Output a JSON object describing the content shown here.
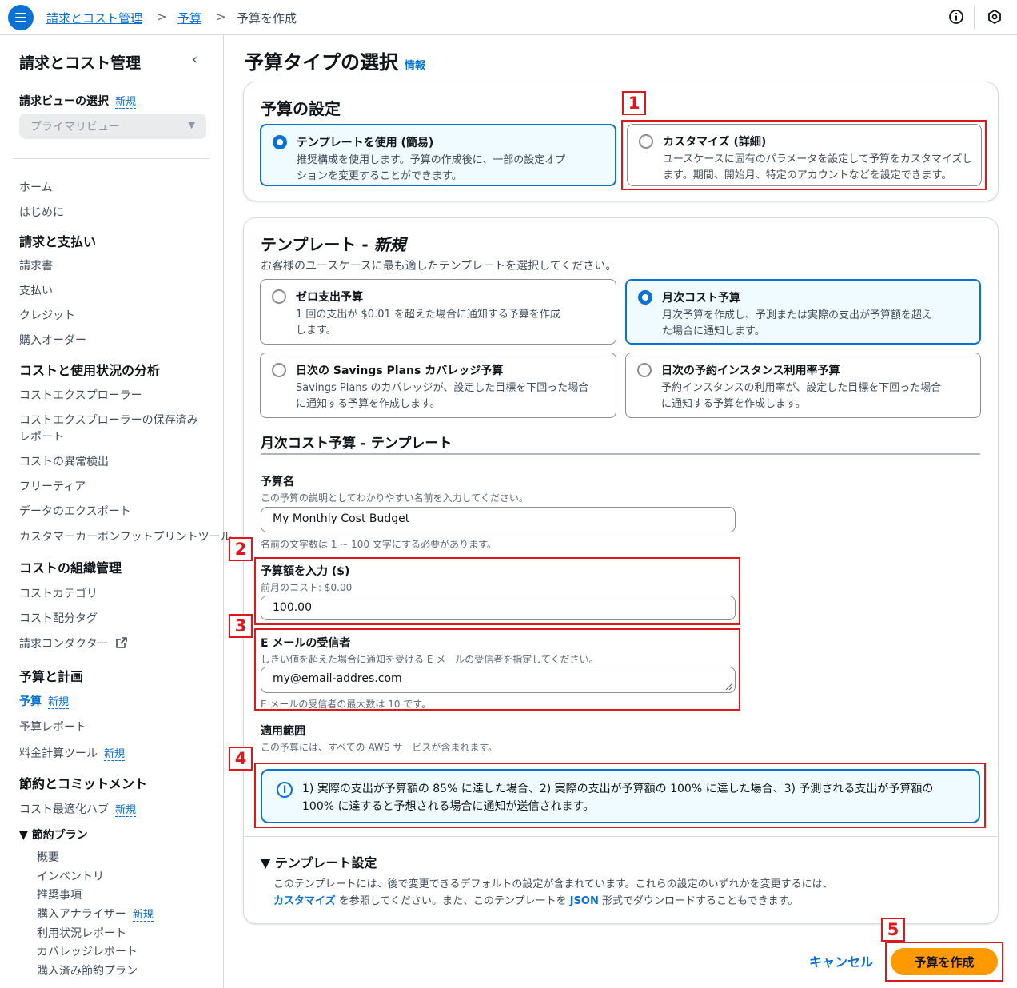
{
  "breadcrumb": {
    "item1": "請求とコスト管理",
    "item2": "予算",
    "current": "予算を作成",
    "separator": ">"
  },
  "sidebar": {
    "title": "請求とコスト管理",
    "billing_view_label": "請求ビューの選択",
    "billing_view_new": "新規",
    "billing_view_value": "プライマリビュー",
    "items": {
      "home": "ホーム",
      "getting_started": "はじめに",
      "billing_payments_head": "請求と支払い",
      "bills": "請求書",
      "payments": "支払い",
      "credits": "クレジット",
      "purchase_orders": "購入オーダー",
      "cost_analysis_head": "コストと使用状況の分析",
      "cost_explorer": "コストエクスプローラー",
      "cost_explorer_saved_1": "コストエクスプローラーの保存済み",
      "cost_explorer_saved_2": "レポート",
      "anomaly": "コストの異常検出",
      "free_tier": "フリーティア",
      "data_exports": "データのエクスポート",
      "carbon": "カスタマーカーボンフットプリントツール",
      "cost_org_head": "コストの組織管理",
      "cost_categories": "コストカテゴリ",
      "cost_tags": "コスト配分タグ",
      "billing_conductor": "請求コンダクター",
      "budget_plan_head": "予算と計画",
      "budgets": "予算",
      "budgets_new": "新規",
      "budget_reports": "予算レポート",
      "pricing_calc": "料金計算ツール",
      "pricing_calc_new": "新規",
      "savings_head": "節約とコミットメント",
      "cost_opt_hub": "コスト最適化ハブ",
      "cost_opt_hub_new": "新規",
      "savings_plans": "▼ 節約プラン",
      "overview": "概要",
      "inventory": "インベントリ",
      "recommendations": "推奨事項",
      "purchase_analyzer": "購入アナライザー",
      "purchase_analyzer_new": "新規",
      "utilization": "利用状況レポート",
      "coverage": "カバレッジレポート",
      "purchased": "購入済み節約プラン"
    }
  },
  "main": {
    "title": "予算タイプの選択",
    "info": "情報",
    "budget_setup": {
      "heading": "予算の設定",
      "template_title": "テンプレートを使用 (簡易)",
      "template_desc": "推奨構成を使用します。予算の作成後に、一部の設定オプションを変更することができます。",
      "custom_title": "カスタマイズ (詳細)",
      "custom_desc": "ユースケースに固有のパラメータを設定して予算をカスタマイズします。期間、開始月、特定のアカウントなどを設定できます。"
    },
    "templates": {
      "heading": "テンプレート - ",
      "heading_new": "新規",
      "subtitle": "お客様のユースケースに最も適したテンプレートを選択してください。",
      "zero_title": "ゼロ支出予算",
      "zero_desc": "1 回の支出が $0.01 を超えた場合に通知する予算を作成します。",
      "monthly_title": "月次コスト予算",
      "monthly_desc": "月次予算を作成し、予測または実際の支出が予算額を超えた場合に通知します。",
      "sp_title": "日次の Savings Plans カバレッジ予算",
      "sp_desc": "Savings Plans のカバレッジが、設定した目標を下回った場合に通知する予算を作成します。",
      "ri_title": "日次の予約インスタンス利用率予算",
      "ri_desc": "予約インスタンスの利用率が、設定した目標を下回った場合に通知する予算を作成します。"
    },
    "form": {
      "section_title": "月次コスト予算 - テンプレート",
      "name_label": "予算名",
      "name_desc": "この予算の説明としてわかりやすい名前を入力してください。",
      "name_value": "My Monthly Cost Budget",
      "name_hint": "名前の文字数は 1 ~ 100 文字にする必要があります。",
      "amount_label": "予算額を入力 ($)",
      "amount_desc": "前月のコスト: $0.00",
      "amount_value": "100.00",
      "email_label": "E メールの受信者",
      "email_desc": "しきい値を超えた場合に通知を受ける E メールの受信者を指定してください。",
      "email_value": "my@email-addres.com",
      "email_hint": "E メールの受信者の最大数は 10 です。",
      "scope_label": "適用範囲",
      "scope_desc": "この予算には、すべての AWS サービスが含まれます。",
      "alert_text": "1) 実際の支出が予算額の 85% に達した場合、2) 実際の支出が予算額の 100% に達した場合、3) 予測される支出が予算額の 100% に達すると予想される場合に通知が送信されます。"
    },
    "template_settings": {
      "heading": "▼ テンプレート設定",
      "text_1": "このテンプレートには、後で変更できるデフォルトの設定が含まれています。これらの設定のいずれかを変更するには、",
      "link_customize": "カスタマイズ",
      "text_2": " を参照してください。また、このテンプレートを ",
      "link_json": "JSON",
      "text_3": " 形式でダウンロードすることもできます。"
    },
    "buttons": {
      "cancel": "キャンセル",
      "create": "予算を作成"
    }
  },
  "annotations": [
    "1",
    "2",
    "3",
    "4",
    "5"
  ],
  "colors": {
    "accent": "#0972d3",
    "primary_button": "#ff9900",
    "annotation": "#e0181b"
  }
}
